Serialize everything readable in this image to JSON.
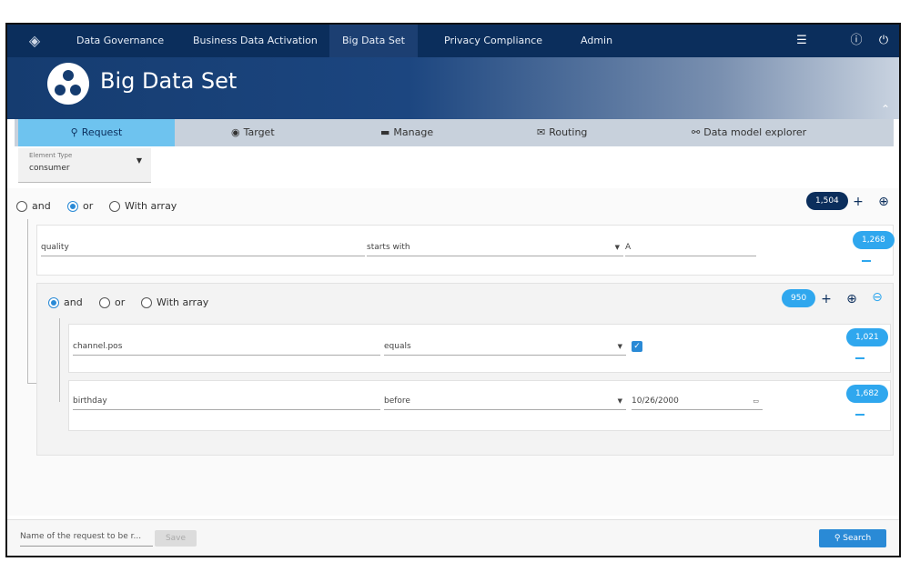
{
  "topnav": {
    "items": [
      {
        "label": "Data Governance"
      },
      {
        "label": "Business Data Activation"
      },
      {
        "label": "Big Data Set"
      },
      {
        "label": "Privacy Compliance"
      },
      {
        "label": "Admin"
      }
    ],
    "active_index": 2,
    "icons": [
      "tiger-logo-icon",
      "list-menu-icon",
      "info-icon",
      "power-icon"
    ]
  },
  "header": {
    "title": "Big Data Set",
    "icon": "bubbles-icon"
  },
  "tabs": [
    {
      "label": "Request",
      "icon": "search-icon"
    },
    {
      "label": "Target",
      "icon": "target-icon"
    },
    {
      "label": "Manage",
      "icon": "folder-icon"
    },
    {
      "label": "Routing",
      "icon": "mail-icon"
    },
    {
      "label": "Data model explorer",
      "icon": "sitemap-icon"
    }
  ],
  "element_type": {
    "label": "Element Type",
    "value": "consumer"
  },
  "root_group": {
    "operators": [
      {
        "label": "and",
        "selected": false
      },
      {
        "label": "or",
        "selected": true
      },
      {
        "label": "With array",
        "selected": false
      }
    ],
    "count": "1,504",
    "condition": {
      "field": "quality",
      "operator": "starts with",
      "value": "A",
      "count": "1,268"
    }
  },
  "sub_group": {
    "operators": [
      {
        "label": "and",
        "selected": true
      },
      {
        "label": "or",
        "selected": false
      },
      {
        "label": "With array",
        "selected": false
      }
    ],
    "count": "950",
    "conditions": [
      {
        "field": "channel.pos",
        "operator": "equals",
        "value_checked": true,
        "count": "1,021"
      },
      {
        "field": "birthday",
        "operator": "before",
        "value": "10/26/2000",
        "count": "1,682"
      }
    ]
  },
  "footer": {
    "name_placeholder": "Name of the request to be r...",
    "save_label": "Save",
    "search_label": "Search"
  },
  "colors": {
    "nav": "#0b2e5c",
    "accent": "#2fa7ee",
    "tab_active": "#6ec3ef"
  }
}
